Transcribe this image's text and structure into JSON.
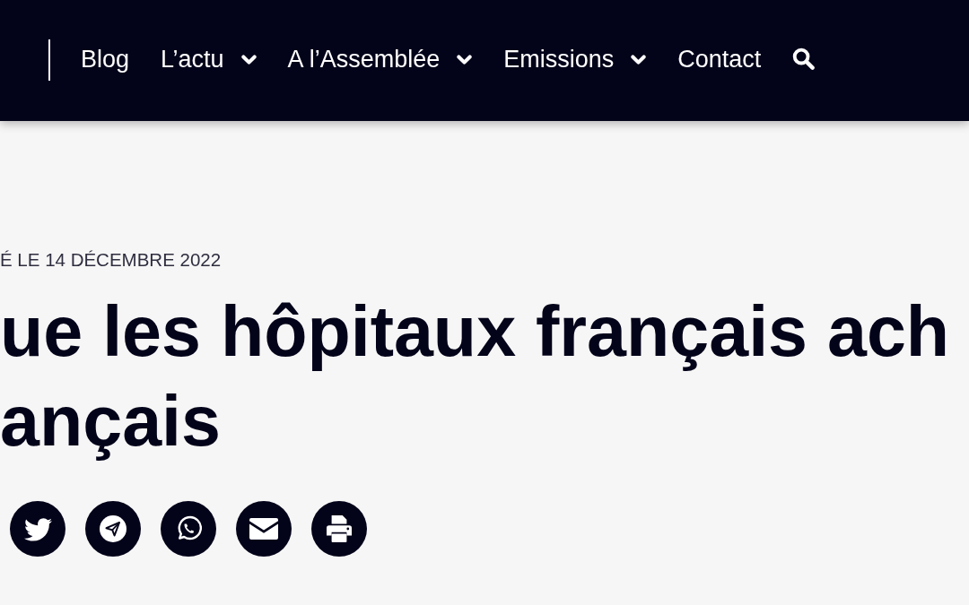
{
  "nav": {
    "items": [
      {
        "label": "Blog",
        "dropdown": false
      },
      {
        "label": "L’actu",
        "dropdown": true
      },
      {
        "label": "A l’Assemblée",
        "dropdown": true
      },
      {
        "label": "Emissions",
        "dropdown": true
      },
      {
        "label": "Contact",
        "dropdown": false
      }
    ]
  },
  "article": {
    "date": "É LE 14 DÉCEMBRE 2022",
    "title_lines": [
      "ue les hôpitaux français ach",
      "ançais"
    ],
    "share_buttons": [
      {
        "kind": "bird"
      },
      {
        "kind": "plane"
      },
      {
        "kind": "chat-phone"
      },
      {
        "kind": "envelope"
      },
      {
        "kind": "printer"
      }
    ]
  }
}
